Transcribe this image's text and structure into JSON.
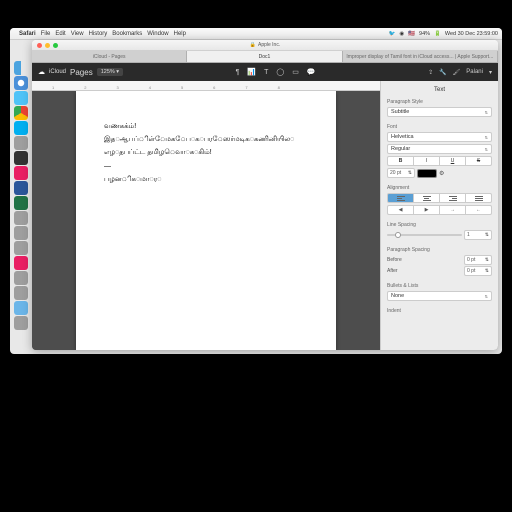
{
  "menubar": {
    "app": "Safari",
    "items": [
      "File",
      "Edit",
      "View",
      "History",
      "Bookmarks",
      "Window",
      "Help"
    ],
    "battery": "94%",
    "datetime": "Wed 30 Dec  23:59:00"
  },
  "browser": {
    "url_host": "Apple Inc.",
    "tabs": [
      {
        "label": "iCloud - Pages",
        "active": false
      },
      {
        "label": "Doc1",
        "active": true
      },
      {
        "label": "Improper display of Tamil font in iCloud access... | Apple Support...",
        "active": false
      }
    ]
  },
  "pages": {
    "brand": "iCloud",
    "product": "Pages",
    "zoom": "125%",
    "user": "Palani"
  },
  "ruler": [
    "1",
    "2",
    "3",
    "4",
    "5",
    "6",
    "7",
    "8"
  ],
  "document": {
    "lines": [
      "வணகக்ம்!",
      "இத◌ஆபப்ிள்ேமக◌ேப◌க◌பர◌ேஸர்மடிக◌கணினியில◌",
      "எழ◌தபப்ட்ட தமிழ◌ெவா◌க◌கிம்!",
      "—",
      "பழன◌ிக◌மா◌ர◌"
    ]
  },
  "sidebar": {
    "title": "Text",
    "para_style_label": "Paragraph Style",
    "para_style": "Subtitle",
    "font_label": "Font",
    "font_family": "Helvetica",
    "font_weight": "Regular",
    "style_buttons": [
      "B",
      "I",
      "U",
      "S"
    ],
    "font_size": "20 pt",
    "alignment_label": "Alignment",
    "line_spacing_label": "Line Spacing",
    "line_spacing": "1",
    "para_spacing_label": "Paragraph Spacing",
    "before_label": "Before",
    "before": "0 pt",
    "after_label": "After",
    "after": "0 pt",
    "bullets_label": "Bullets & Lists",
    "bullets": "None",
    "indent_label": "Indent"
  }
}
